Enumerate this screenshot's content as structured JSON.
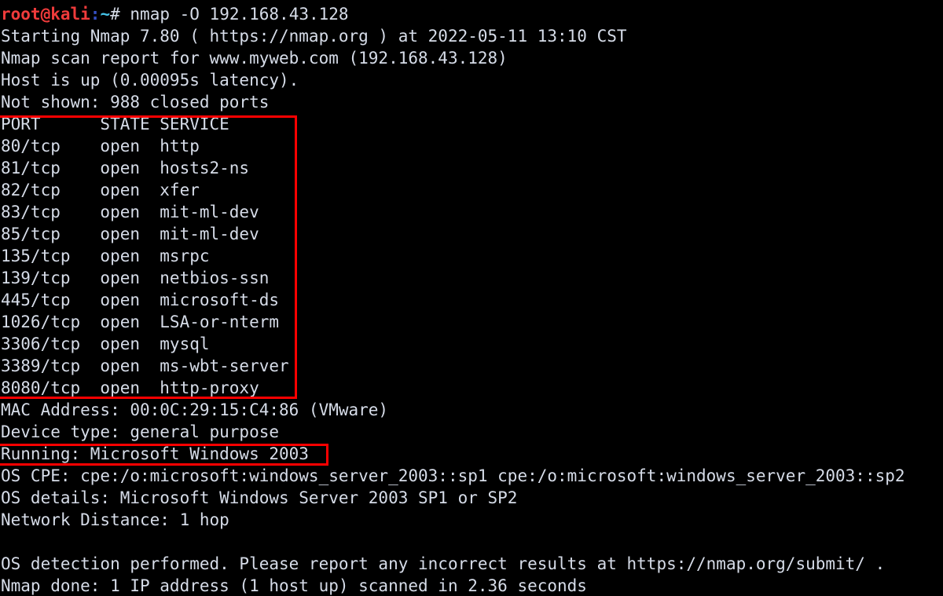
{
  "terminal": {
    "background_color": "#000000",
    "text_color": "#d6dce8",
    "highlight_color": "#fe0000",
    "prompt": {
      "user_host": "root@kali",
      "colon": ":",
      "path": "~",
      "sigil": "#",
      "user_host_color": "#ef3b3b",
      "colon_color": "#3450c4",
      "path_color": "#45c3e8",
      "command": " nmap -O 192.168.43.128"
    },
    "output_lines": [
      "Starting Nmap 7.80 ( https://nmap.org ) at 2022-05-11 13:10 CST",
      "Nmap scan report for www.myweb.com (192.168.43.128)",
      "Host is up (0.00095s latency).",
      "Not shown: 988 closed ports",
      "PORT      STATE SERVICE",
      "80/tcp    open  http",
      "81/tcp    open  hosts2-ns",
      "82/tcp    open  xfer",
      "83/tcp    open  mit-ml-dev",
      "85/tcp    open  mit-ml-dev",
      "135/tcp   open  msrpc",
      "139/tcp   open  netbios-ssn",
      "445/tcp   open  microsoft-ds",
      "1026/tcp  open  LSA-or-nterm",
      "3306/tcp  open  mysql",
      "3389/tcp  open  ms-wbt-server",
      "8080/tcp  open  http-proxy",
      "MAC Address: 00:0C:29:15:C4:86 (VMware)",
      "Device type: general purpose",
      "Running: Microsoft Windows 2003",
      "OS CPE: cpe:/o:microsoft:windows_server_2003::sp1 cpe:/o:microsoft:windows_server_2003::sp2",
      "OS details: Microsoft Windows Server 2003 SP1 or SP2",
      "Network Distance: 1 hop",
      "",
      "OS detection performed. Please report any incorrect results at https://nmap.org/submit/ .",
      "Nmap done: 1 IP address (1 host up) scanned in 2.36 seconds"
    ]
  },
  "scan_details": {
    "nmap_version": "7.80",
    "nmap_url": "https://nmap.org",
    "scan_timestamp": "2022-05-11 13:10 CST",
    "target_hostname": "www.myweb.com",
    "target_ip": "192.168.43.128",
    "host_status": "up",
    "latency": "0.00095s",
    "closed_ports_not_shown": "988",
    "mac_address": "00:0C:29:15:C4:86",
    "mac_vendor": "VMware",
    "device_type": "general purpose",
    "running_os": "Microsoft Windows 2003",
    "os_cpe": "cpe:/o:microsoft:windows_server_2003::sp1 cpe:/o:microsoft:windows_server_2003::sp2",
    "os_details": "Microsoft Windows Server 2003 SP1 or SP2",
    "network_distance": "1 hop",
    "submit_url": "https://nmap.org/submit/",
    "ip_addresses_scanned": "1",
    "hosts_up": "1",
    "scan_duration": "2.36 seconds"
  },
  "port_table": {
    "headers": [
      "PORT",
      "STATE",
      "SERVICE"
    ],
    "rows": [
      [
        "80/tcp",
        "open",
        "http"
      ],
      [
        "81/tcp",
        "open",
        "hosts2-ns"
      ],
      [
        "82/tcp",
        "open",
        "xfer"
      ],
      [
        "83/tcp",
        "open",
        "mit-ml-dev"
      ],
      [
        "85/tcp",
        "open",
        "mit-ml-dev"
      ],
      [
        "135/tcp",
        "open",
        "msrpc"
      ],
      [
        "139/tcp",
        "open",
        "netbios-ssn"
      ],
      [
        "445/tcp",
        "open",
        "microsoft-ds"
      ],
      [
        "1026/tcp",
        "open",
        "LSA-or-nterm"
      ],
      [
        "3306/tcp",
        "open",
        "mysql"
      ],
      [
        "3389/tcp",
        "open",
        "ms-wbt-server"
      ],
      [
        "8080/tcp",
        "open",
        "http-proxy"
      ]
    ]
  },
  "annotations": [
    {
      "name": "port-table-highlight",
      "color": "#fe0000"
    },
    {
      "name": "running-os-highlight",
      "color": "#fe0000"
    }
  ]
}
